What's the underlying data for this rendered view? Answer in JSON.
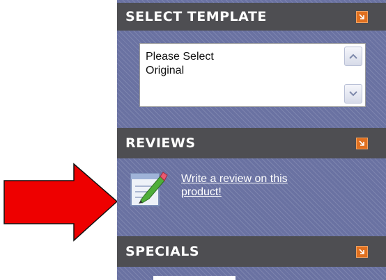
{
  "select_template": {
    "title": "SELECT TEMPLATE",
    "options": [
      "Please Select",
      "Original"
    ]
  },
  "reviews": {
    "title": "REVIEWS",
    "link_line1": "Write a review on this",
    "link_line2": "product!"
  },
  "specials": {
    "title": "SPECIALS"
  },
  "colors": {
    "header_bg": "#4e4e52",
    "panel_bg": "#6a72a2",
    "header_button": "#e07020",
    "pointer_arrow": "#ee0000"
  },
  "icons": [
    "collapse-arrow-icon",
    "scroll-up-icon",
    "scroll-down-icon",
    "write-review-icon",
    "red-pointer-arrow"
  ]
}
